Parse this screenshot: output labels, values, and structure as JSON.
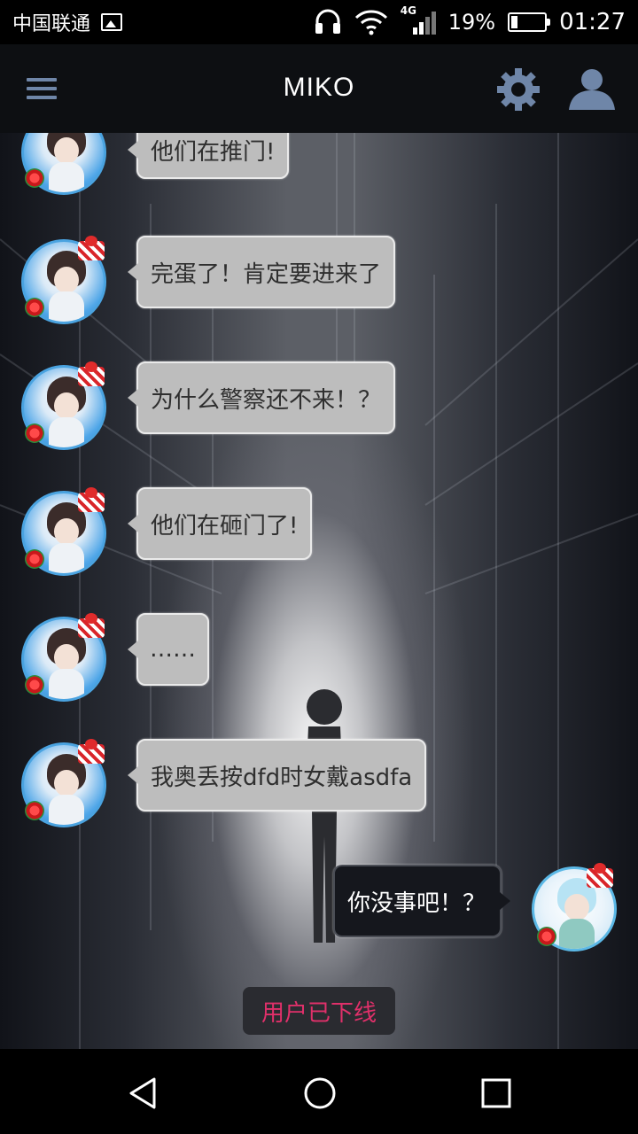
{
  "statusbar": {
    "carrier": "中国联通",
    "network": "4G",
    "battery_percent_text": "19%",
    "battery_level": 0.19,
    "time": "01:27",
    "icons": [
      "picture-icon",
      "headset-icon",
      "wifi-icon",
      "signal-icon",
      "battery-icon"
    ]
  },
  "appbar": {
    "title": "MIKO",
    "icons": [
      "menu-icon",
      "gear-icon",
      "user-icon"
    ],
    "accent": "#6f86a8"
  },
  "messages": [
    {
      "sender": "other",
      "text": "他们在推门!"
    },
    {
      "sender": "other",
      "text": "完蛋了！肯定要进来了"
    },
    {
      "sender": "other",
      "text": "为什么警察还不来！？"
    },
    {
      "sender": "other",
      "text": "他们在砸门了!"
    },
    {
      "sender": "other",
      "text": "……"
    },
    {
      "sender": "other",
      "text": "我奥丢按dfd时女戴asdfa"
    },
    {
      "sender": "self",
      "text": "你没事吧！？"
    }
  ],
  "system_status": {
    "text": "用户已下线",
    "color": "#e0306a"
  },
  "navbar": {
    "icons": [
      "back-icon",
      "home-icon",
      "recents-icon"
    ]
  }
}
